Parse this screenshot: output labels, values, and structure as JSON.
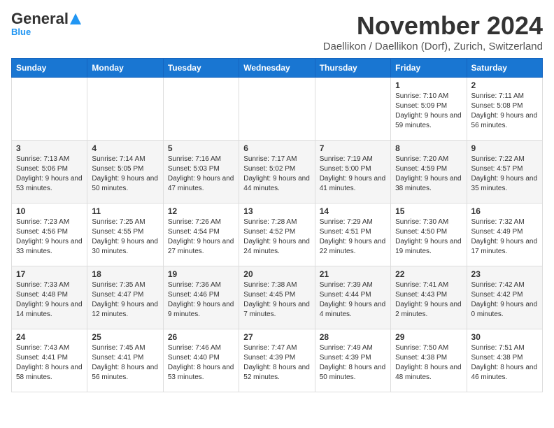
{
  "logo": {
    "text_general": "General",
    "text_blue": "Blue",
    "arrow_symbol": "▶"
  },
  "header": {
    "month_title": "November 2024",
    "location": "Daellikon / Daellikon (Dorf), Zurich, Switzerland"
  },
  "days_of_week": [
    "Sunday",
    "Monday",
    "Tuesday",
    "Wednesday",
    "Thursday",
    "Friday",
    "Saturday"
  ],
  "weeks": [
    {
      "days": [
        {
          "num": "",
          "info": ""
        },
        {
          "num": "",
          "info": ""
        },
        {
          "num": "",
          "info": ""
        },
        {
          "num": "",
          "info": ""
        },
        {
          "num": "",
          "info": ""
        },
        {
          "num": "1",
          "info": "Sunrise: 7:10 AM\nSunset: 5:09 PM\nDaylight: 9 hours and 59 minutes."
        },
        {
          "num": "2",
          "info": "Sunrise: 7:11 AM\nSunset: 5:08 PM\nDaylight: 9 hours and 56 minutes."
        }
      ]
    },
    {
      "days": [
        {
          "num": "3",
          "info": "Sunrise: 7:13 AM\nSunset: 5:06 PM\nDaylight: 9 hours and 53 minutes."
        },
        {
          "num": "4",
          "info": "Sunrise: 7:14 AM\nSunset: 5:05 PM\nDaylight: 9 hours and 50 minutes."
        },
        {
          "num": "5",
          "info": "Sunrise: 7:16 AM\nSunset: 5:03 PM\nDaylight: 9 hours and 47 minutes."
        },
        {
          "num": "6",
          "info": "Sunrise: 7:17 AM\nSunset: 5:02 PM\nDaylight: 9 hours and 44 minutes."
        },
        {
          "num": "7",
          "info": "Sunrise: 7:19 AM\nSunset: 5:00 PM\nDaylight: 9 hours and 41 minutes."
        },
        {
          "num": "8",
          "info": "Sunrise: 7:20 AM\nSunset: 4:59 PM\nDaylight: 9 hours and 38 minutes."
        },
        {
          "num": "9",
          "info": "Sunrise: 7:22 AM\nSunset: 4:57 PM\nDaylight: 9 hours and 35 minutes."
        }
      ]
    },
    {
      "days": [
        {
          "num": "10",
          "info": "Sunrise: 7:23 AM\nSunset: 4:56 PM\nDaylight: 9 hours and 33 minutes."
        },
        {
          "num": "11",
          "info": "Sunrise: 7:25 AM\nSunset: 4:55 PM\nDaylight: 9 hours and 30 minutes."
        },
        {
          "num": "12",
          "info": "Sunrise: 7:26 AM\nSunset: 4:54 PM\nDaylight: 9 hours and 27 minutes."
        },
        {
          "num": "13",
          "info": "Sunrise: 7:28 AM\nSunset: 4:52 PM\nDaylight: 9 hours and 24 minutes."
        },
        {
          "num": "14",
          "info": "Sunrise: 7:29 AM\nSunset: 4:51 PM\nDaylight: 9 hours and 22 minutes."
        },
        {
          "num": "15",
          "info": "Sunrise: 7:30 AM\nSunset: 4:50 PM\nDaylight: 9 hours and 19 minutes."
        },
        {
          "num": "16",
          "info": "Sunrise: 7:32 AM\nSunset: 4:49 PM\nDaylight: 9 hours and 17 minutes."
        }
      ]
    },
    {
      "days": [
        {
          "num": "17",
          "info": "Sunrise: 7:33 AM\nSunset: 4:48 PM\nDaylight: 9 hours and 14 minutes."
        },
        {
          "num": "18",
          "info": "Sunrise: 7:35 AM\nSunset: 4:47 PM\nDaylight: 9 hours and 12 minutes."
        },
        {
          "num": "19",
          "info": "Sunrise: 7:36 AM\nSunset: 4:46 PM\nDaylight: 9 hours and 9 minutes."
        },
        {
          "num": "20",
          "info": "Sunrise: 7:38 AM\nSunset: 4:45 PM\nDaylight: 9 hours and 7 minutes."
        },
        {
          "num": "21",
          "info": "Sunrise: 7:39 AM\nSunset: 4:44 PM\nDaylight: 9 hours and 4 minutes."
        },
        {
          "num": "22",
          "info": "Sunrise: 7:41 AM\nSunset: 4:43 PM\nDaylight: 9 hours and 2 minutes."
        },
        {
          "num": "23",
          "info": "Sunrise: 7:42 AM\nSunset: 4:42 PM\nDaylight: 9 hours and 0 minutes."
        }
      ]
    },
    {
      "days": [
        {
          "num": "24",
          "info": "Sunrise: 7:43 AM\nSunset: 4:41 PM\nDaylight: 8 hours and 58 minutes."
        },
        {
          "num": "25",
          "info": "Sunrise: 7:45 AM\nSunset: 4:41 PM\nDaylight: 8 hours and 56 minutes."
        },
        {
          "num": "26",
          "info": "Sunrise: 7:46 AM\nSunset: 4:40 PM\nDaylight: 8 hours and 53 minutes."
        },
        {
          "num": "27",
          "info": "Sunrise: 7:47 AM\nSunset: 4:39 PM\nDaylight: 8 hours and 52 minutes."
        },
        {
          "num": "28",
          "info": "Sunrise: 7:49 AM\nSunset: 4:39 PM\nDaylight: 8 hours and 50 minutes."
        },
        {
          "num": "29",
          "info": "Sunrise: 7:50 AM\nSunset: 4:38 PM\nDaylight: 8 hours and 48 minutes."
        },
        {
          "num": "30",
          "info": "Sunrise: 7:51 AM\nSunset: 4:38 PM\nDaylight: 8 hours and 46 minutes."
        }
      ]
    }
  ]
}
